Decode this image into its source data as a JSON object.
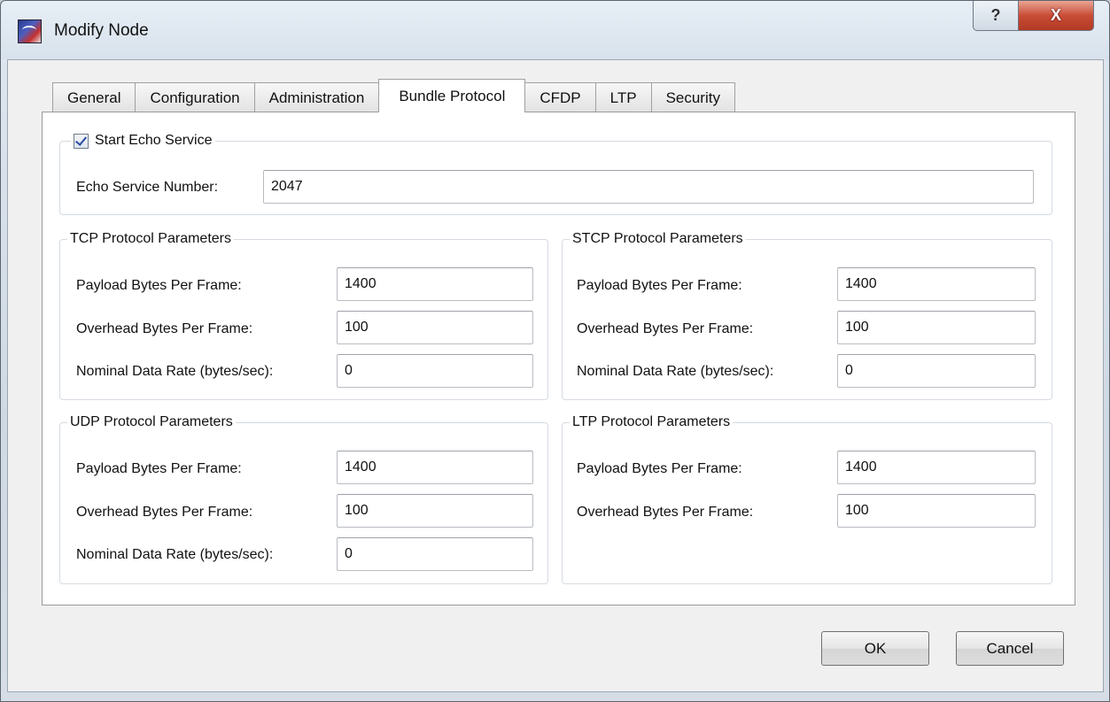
{
  "window": {
    "title": "Modify Node",
    "help_label": "?",
    "close_label": "X"
  },
  "tabs": [
    {
      "label": "General"
    },
    {
      "label": "Configuration"
    },
    {
      "label": "Administration"
    },
    {
      "label": "Bundle Protocol",
      "active": true
    },
    {
      "label": "CFDP"
    },
    {
      "label": "LTP"
    },
    {
      "label": "Security"
    }
  ],
  "echo": {
    "checkbox_label": "Start Echo Service",
    "checked": true,
    "number_label": "Echo Service  Number:",
    "number_value": "2047"
  },
  "tcp": {
    "title": "TCP Protocol Parameters",
    "payload_label": "Payload Bytes Per Frame:",
    "payload_value": "1400",
    "overhead_label": "Overhead Bytes Per Frame:",
    "overhead_value": "100",
    "rate_label": "Nominal Data Rate (bytes/sec):",
    "rate_value": "0"
  },
  "stcp": {
    "title": "STCP Protocol Parameters",
    "payload_label": "Payload Bytes Per Frame:",
    "payload_value": "1400",
    "overhead_label": "Overhead Bytes Per Frame:",
    "overhead_value": "100",
    "rate_label": "Nominal Data Rate (bytes/sec):",
    "rate_value": "0"
  },
  "udp": {
    "title": "UDP Protocol Parameters",
    "payload_label": "Payload Bytes Per Frame:",
    "payload_value": "1400",
    "overhead_label": "Overhead Bytes Per Frame:",
    "overhead_value": "100",
    "rate_label": "Nominal Data Rate (bytes/sec):",
    "rate_value": "0"
  },
  "ltp": {
    "title": "LTP Protocol Parameters",
    "payload_label": "Payload Bytes Per Frame:",
    "payload_value": "1400",
    "overhead_label": "Overhead Bytes Per Frame:",
    "overhead_value": "100"
  },
  "buttons": {
    "ok_label": "OK",
    "cancel_label": "Cancel"
  },
  "icons": {
    "app": "satellite-app-icon",
    "help": "help-icon",
    "close": "close-icon",
    "check": "checkmark-icon"
  },
  "colors": {
    "close_button": "#c94c36",
    "checkmark": "#2b4aa6"
  }
}
